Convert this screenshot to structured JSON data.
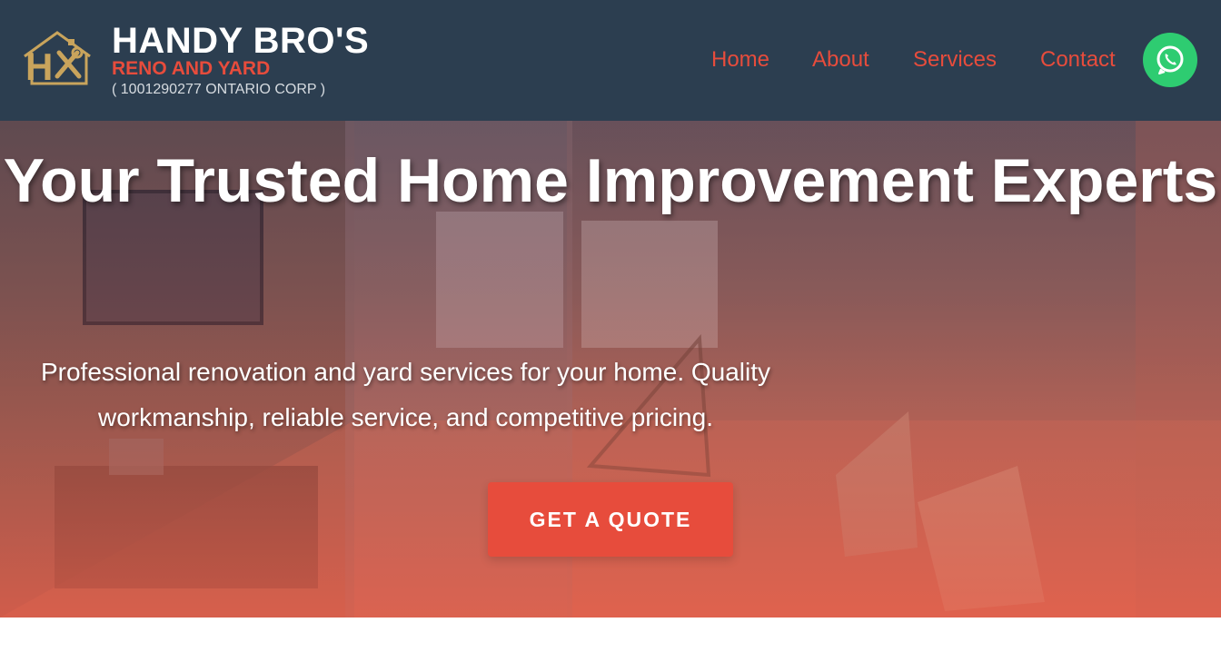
{
  "brand": {
    "title": "HANDY BRO'S",
    "subtitle": "RENO AND YARD",
    "corp": "( 1001290277 ONTARIO CORP )",
    "logo_letter": "H",
    "logo_color": "#c9a45c"
  },
  "nav": {
    "home": "Home",
    "about": "About",
    "services": "Services",
    "contact": "Contact"
  },
  "whatsapp": {
    "icon": "whatsapp-icon",
    "color": "#2ecc71"
  },
  "hero": {
    "title": "Your Trusted Home Improvement Experts",
    "subtitle": "Professional renovation and yard services for your home. Quality workmanship, reliable service, and competitive pricing.",
    "cta": "GET A QUOTE"
  },
  "colors": {
    "header_bg": "#2c3e50",
    "accent": "#e74c3c",
    "white": "#ffffff"
  }
}
